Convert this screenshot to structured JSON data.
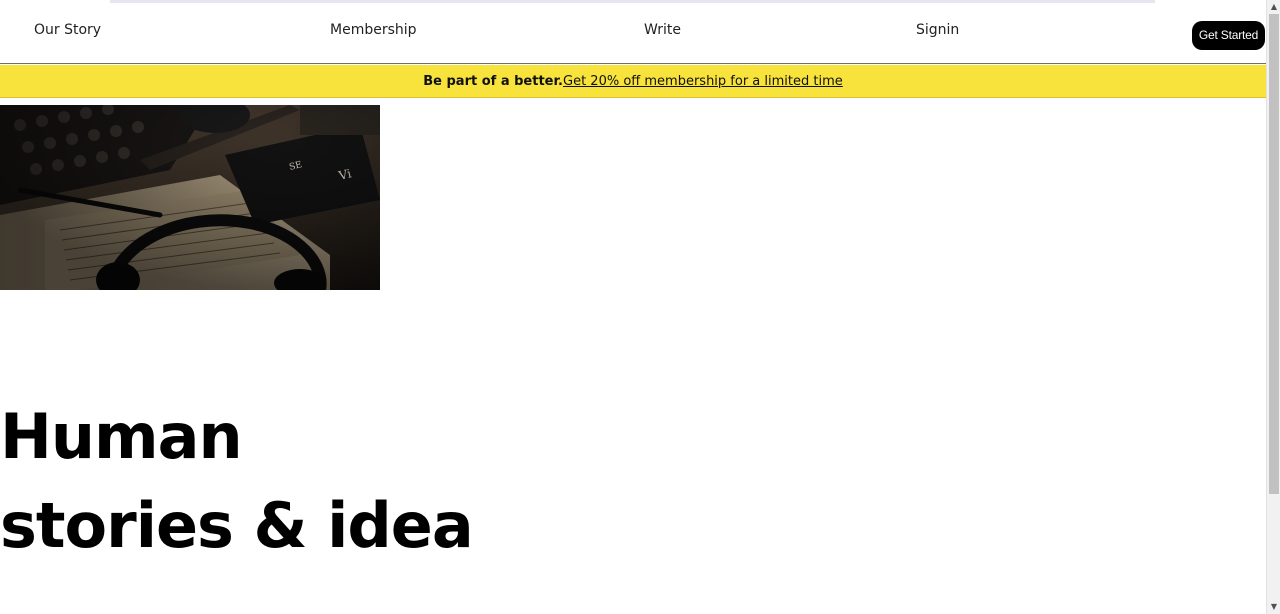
{
  "nav": {
    "items": [
      {
        "label": "Our Story"
      },
      {
        "label": "Membership"
      },
      {
        "label": "Write"
      },
      {
        "label": "Signin"
      }
    ],
    "cta_label": "Get Started"
  },
  "promo": {
    "bold_text": "Be part of a better.",
    "link_text": "Get 20% off membership for a limited time",
    "background_color": "#f7e33b"
  },
  "hero": {
    "image_description": "hero-photo",
    "headline_line1": "Human",
    "headline_line2": "stories & idea"
  },
  "scrollbar": {
    "up_icon": "▲",
    "down_icon": "▼"
  }
}
